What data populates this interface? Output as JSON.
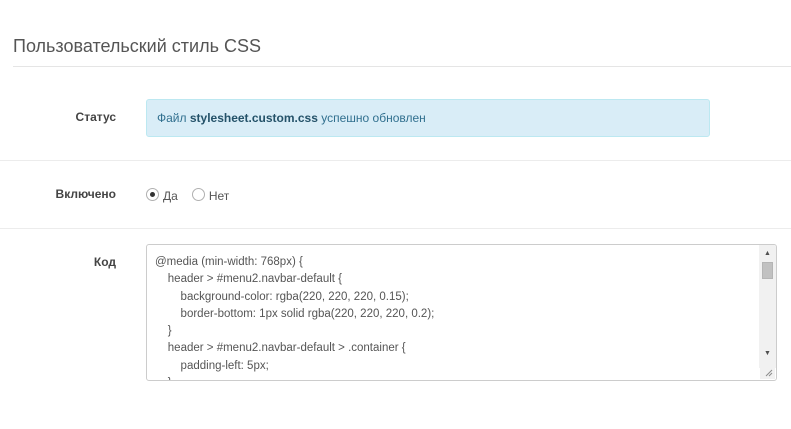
{
  "page": {
    "title": "Пользовательский стиль CSS"
  },
  "status": {
    "label": "Статус",
    "message_prefix": "Файл ",
    "filename": "stylesheet.custom.css",
    "message_suffix": " успешно обновлен"
  },
  "enabled": {
    "label": "Включено",
    "options": [
      {
        "label": "Да",
        "checked": true
      },
      {
        "label": "Нет",
        "checked": false
      }
    ]
  },
  "code": {
    "label": "Код",
    "lines": [
      "@media (min-width: 768px) {",
      "    header > #menu2.navbar-default {",
      "        background-color: rgba(220, 220, 220, 0.15);",
      "        border-bottom: 1px solid rgba(220, 220, 220, 0.2);",
      "    }",
      "    header > #menu2.navbar-default > .container {",
      "        padding-left: 5px;",
      "    }"
    ]
  },
  "colors": {
    "alert_background": "#d9edf7",
    "alert_border": "#bce8f1",
    "alert_text": "#31708f"
  }
}
